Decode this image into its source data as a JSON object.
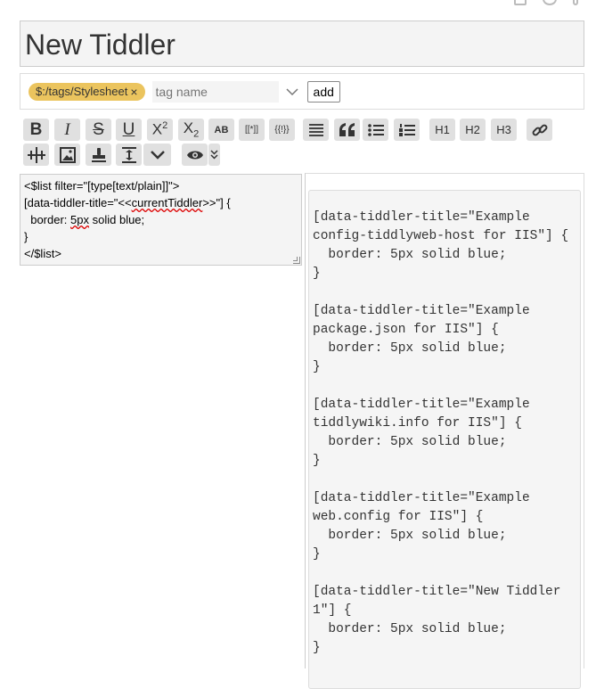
{
  "title": "New Tiddler",
  "tags": {
    "items": [
      {
        "label": "$:/tags/Stylesheet",
        "remove": "×"
      }
    ],
    "input_placeholder": "tag name",
    "add_label": "add"
  },
  "toolbar": {
    "buttons": [
      {
        "name": "bold",
        "icon": "bold-icon",
        "label": "B"
      },
      {
        "name": "italic",
        "icon": "italic-icon",
        "label": "I"
      },
      {
        "name": "strikethrough",
        "icon": "strikethrough-icon",
        "label": "S"
      },
      {
        "name": "underline",
        "icon": "underline-icon",
        "label": "U"
      },
      {
        "name": "superscript",
        "icon": "superscript-icon",
        "label": "X",
        "sub": "2"
      },
      {
        "name": "subscript",
        "icon": "subscript-icon",
        "label": "X",
        "sub": "2"
      },
      {
        "name": "smallcaps",
        "icon": "smallcaps-icon",
        "label": "AB"
      },
      {
        "name": "transclude",
        "icon": "transclude-icon",
        "label": "[[*]]"
      },
      {
        "name": "macro",
        "icon": "macro-icon",
        "label": "{{!}}"
      },
      {
        "name": "h1",
        "icon": "heading-1-icon",
        "label": "H1"
      },
      {
        "name": "h2",
        "icon": "heading-2-icon",
        "label": "H2"
      },
      {
        "name": "h3",
        "icon": "heading-3-icon",
        "label": "H3"
      }
    ]
  },
  "editor": {
    "lines": [
      "<$list filter=\"[type[text/plain]]\">",
      "[data-tiddler-title=\"<<",
      "currentTiddler",
      ">>\"] {",
      "  border: ",
      "5px",
      " solid blue;",
      "}",
      "</$list>"
    ]
  },
  "preview": {
    "text": "[data-tiddler-title=\"Example config-tiddlyweb-host for IIS\"] {\n  border: 5px solid blue;\n}\n\n[data-tiddler-title=\"Example package.json for IIS\"] {\n  border: 5px solid blue;\n}\n\n[data-tiddler-title=\"Example tiddlywiki.info for IIS\"] {\n  border: 5px solid blue;\n}\n\n[data-tiddler-title=\"Example web.config for IIS\"] {\n  border: 5px solid blue;\n}\n\n[data-tiddler-title=\"New Tiddler 1\"] {\n  border: 5px solid blue;\n}"
  },
  "colors": {
    "tag": "#ebc45e",
    "field_bg": "#f4f4f4",
    "button_bg": "#e0e0e0"
  }
}
